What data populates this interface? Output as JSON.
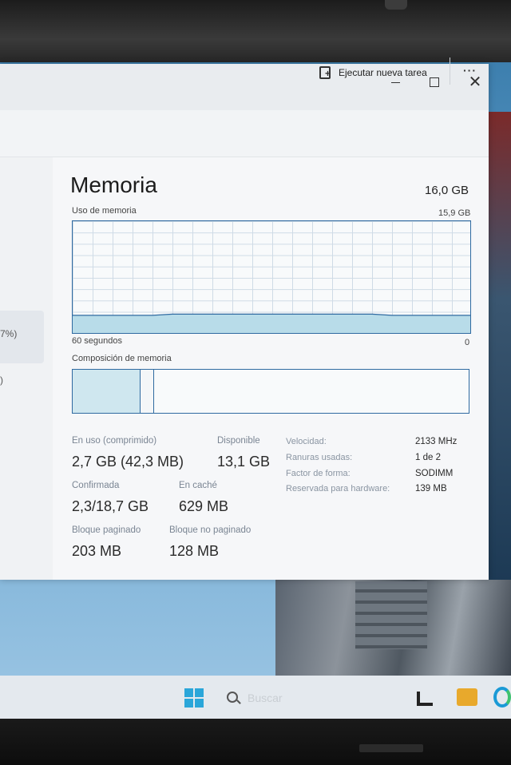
{
  "window": {
    "controls": {
      "minimize": "—",
      "maximize": "□",
      "close": "✕"
    },
    "command_bar": {
      "run_task_label": "Ejecutar nueva tarea",
      "more_label": "···",
      "run_task_icon": "new-task-icon"
    }
  },
  "sidebar": {
    "selected_item_text": "7%)",
    "second_item_text": ")"
  },
  "memory": {
    "title": "Memoria",
    "total": "16,0 GB",
    "usage_graph": {
      "label": "Uso de memoria",
      "max_label": "15,9 GB",
      "time_left": "60 segundos",
      "time_right": "0",
      "used_fraction": 0.17
    },
    "composition": {
      "label": "Composición de memoria",
      "in_use_fraction": 0.17,
      "modified_fraction": 0.035
    },
    "stats": {
      "in_use_label": "En uso (comprimido)",
      "in_use_value": "2,7 GB (42,3 MB)",
      "available_label": "Disponible",
      "available_value": "13,1 GB",
      "committed_label": "Confirmada",
      "committed_value": "2,3/18,7 GB",
      "cached_label": "En caché",
      "cached_value": "629 MB",
      "paged_label": "Bloque paginado",
      "paged_value": "203 MB",
      "nonpaged_label": "Bloque no paginado",
      "nonpaged_value": "128 MB"
    },
    "details": [
      {
        "key": "Velocidad:",
        "value": "2133 MHz"
      },
      {
        "key": "Ranuras usadas:",
        "value": "1 de 2"
      },
      {
        "key": "Factor de forma:",
        "value": "SODIMM"
      },
      {
        "key": "Reservada para hardware:",
        "value": "139 MB"
      }
    ]
  },
  "taskbar": {
    "search_placeholder": "Buscar"
  }
}
